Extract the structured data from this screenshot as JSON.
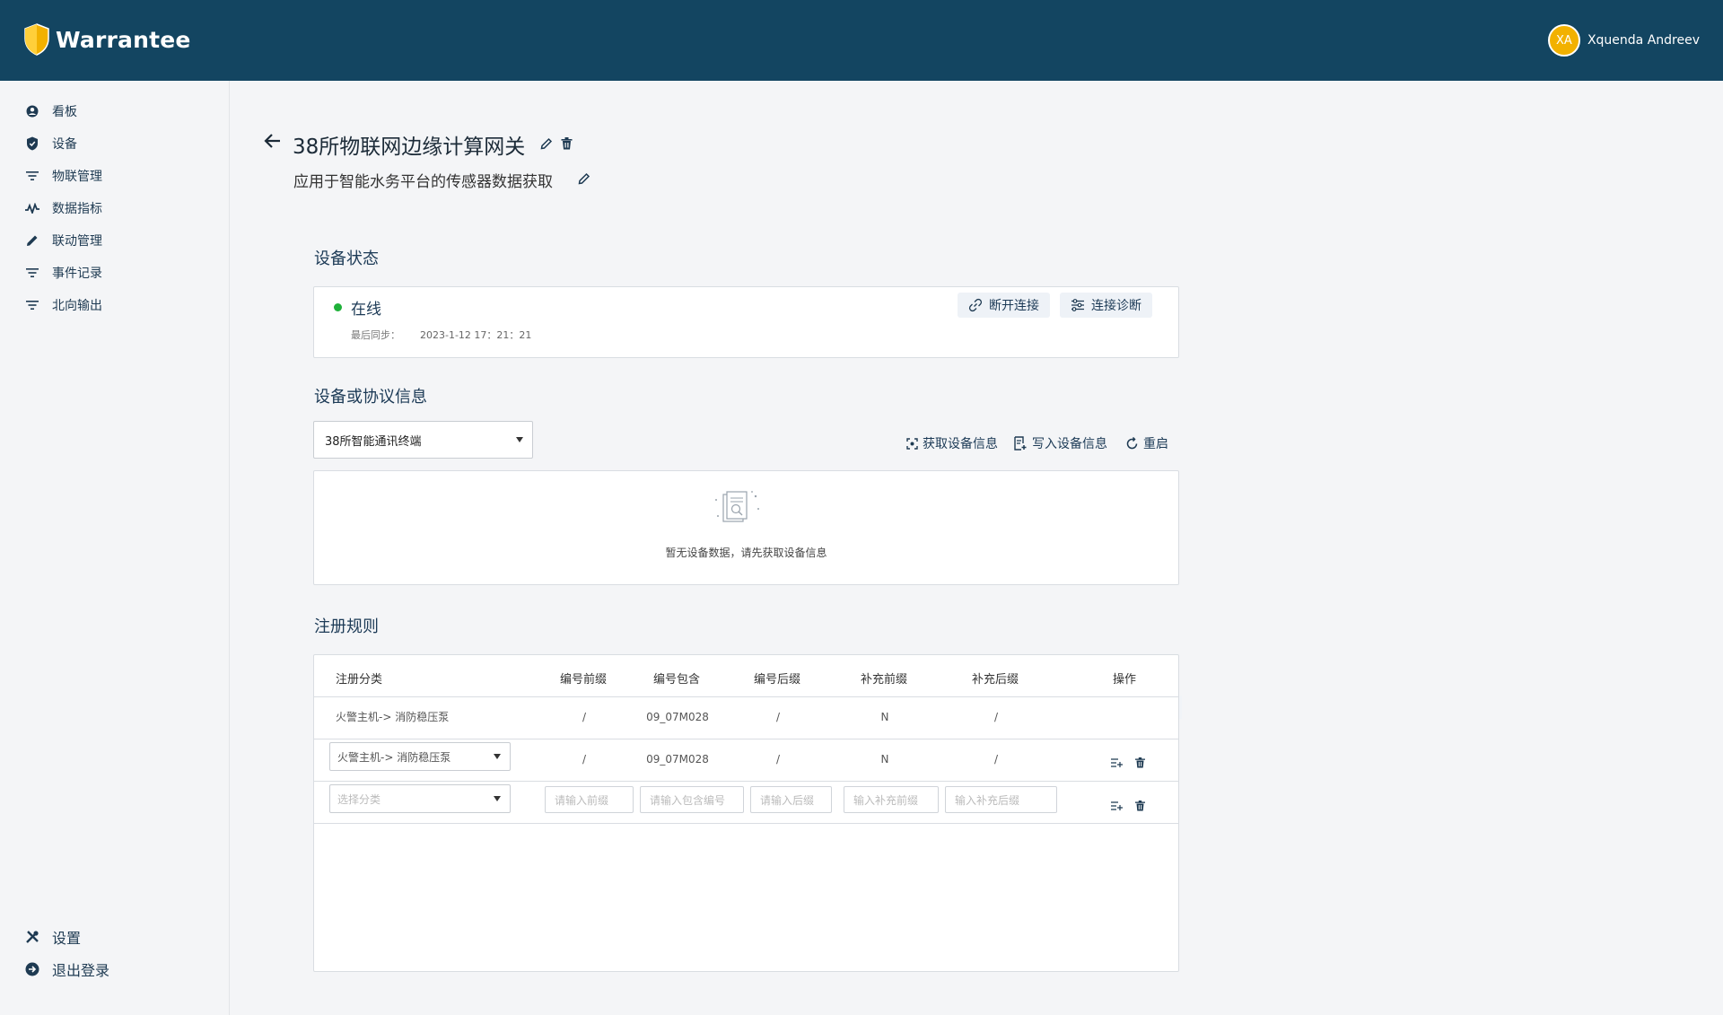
{
  "app": {
    "name": "Warrantee",
    "brand_color": "#134561",
    "accent": "#f2b100"
  },
  "user": {
    "initials": "XA",
    "name": "Xquenda Andreev"
  },
  "sidebar": {
    "items": [
      {
        "label": "看板",
        "icon": "user-circle-icon"
      },
      {
        "label": "设备",
        "icon": "shield-check-icon"
      },
      {
        "label": "物联管理",
        "icon": "filter-icon"
      },
      {
        "label": "数据指标",
        "icon": "activity-icon"
      },
      {
        "label": "联动管理",
        "icon": "pencil-icon"
      },
      {
        "label": "事件记录",
        "icon": "filter-icon"
      },
      {
        "label": "北向输出",
        "icon": "filter-icon"
      }
    ],
    "bottom": [
      {
        "label": "设置",
        "icon": "tools-icon"
      },
      {
        "label": "退出登录",
        "icon": "arrow-right-circle-icon"
      }
    ]
  },
  "page": {
    "title": "38所物联网边缘计算网关",
    "subtitle": "应用于智能水务平台的传感器数据获取"
  },
  "status_section": {
    "title": "设备状态",
    "status": "在线",
    "status_color": "#1fb13a",
    "sync_label": "最后同步：",
    "sync_value": "2023-1-12 17：21：21",
    "disconnect_label": "断开连接",
    "diagnose_label": "连接诊断"
  },
  "protocol_section": {
    "title": "设备或协议信息",
    "selected_device": "38所智能通讯终端",
    "get_info_label": "获取设备信息",
    "write_info_label": "写入设备信息",
    "restart_label": "重启",
    "empty_text": "暂无设备数据，请先获取设备信息"
  },
  "rules_section": {
    "title": "注册规则",
    "headers": [
      "注册分类",
      "编号前缀",
      "编号包含",
      "编号后缀",
      "补充前缀",
      "补充后缀",
      "操作"
    ],
    "rows": [
      {
        "category": "火警主机-> 消防稳压泵",
        "prefix": "/",
        "contains": "09_07M028",
        "suffix": "/",
        "extra_prefix": "N",
        "extra_suffix": "/"
      },
      {
        "category": "火警主机-> 消防稳压泵",
        "prefix": "/",
        "contains": "09_07M028",
        "suffix": "/",
        "extra_prefix": "N",
        "extra_suffix": "/"
      }
    ],
    "new_row": {
      "category_placeholder": "选择分类",
      "prefix_placeholder": "请输入前缀",
      "contains_placeholder": "请输入包含编号",
      "suffix_placeholder": "请输入后缀",
      "extra_prefix_placeholder": "输入补充前缀",
      "extra_suffix_placeholder": "输入补充后缀"
    }
  }
}
